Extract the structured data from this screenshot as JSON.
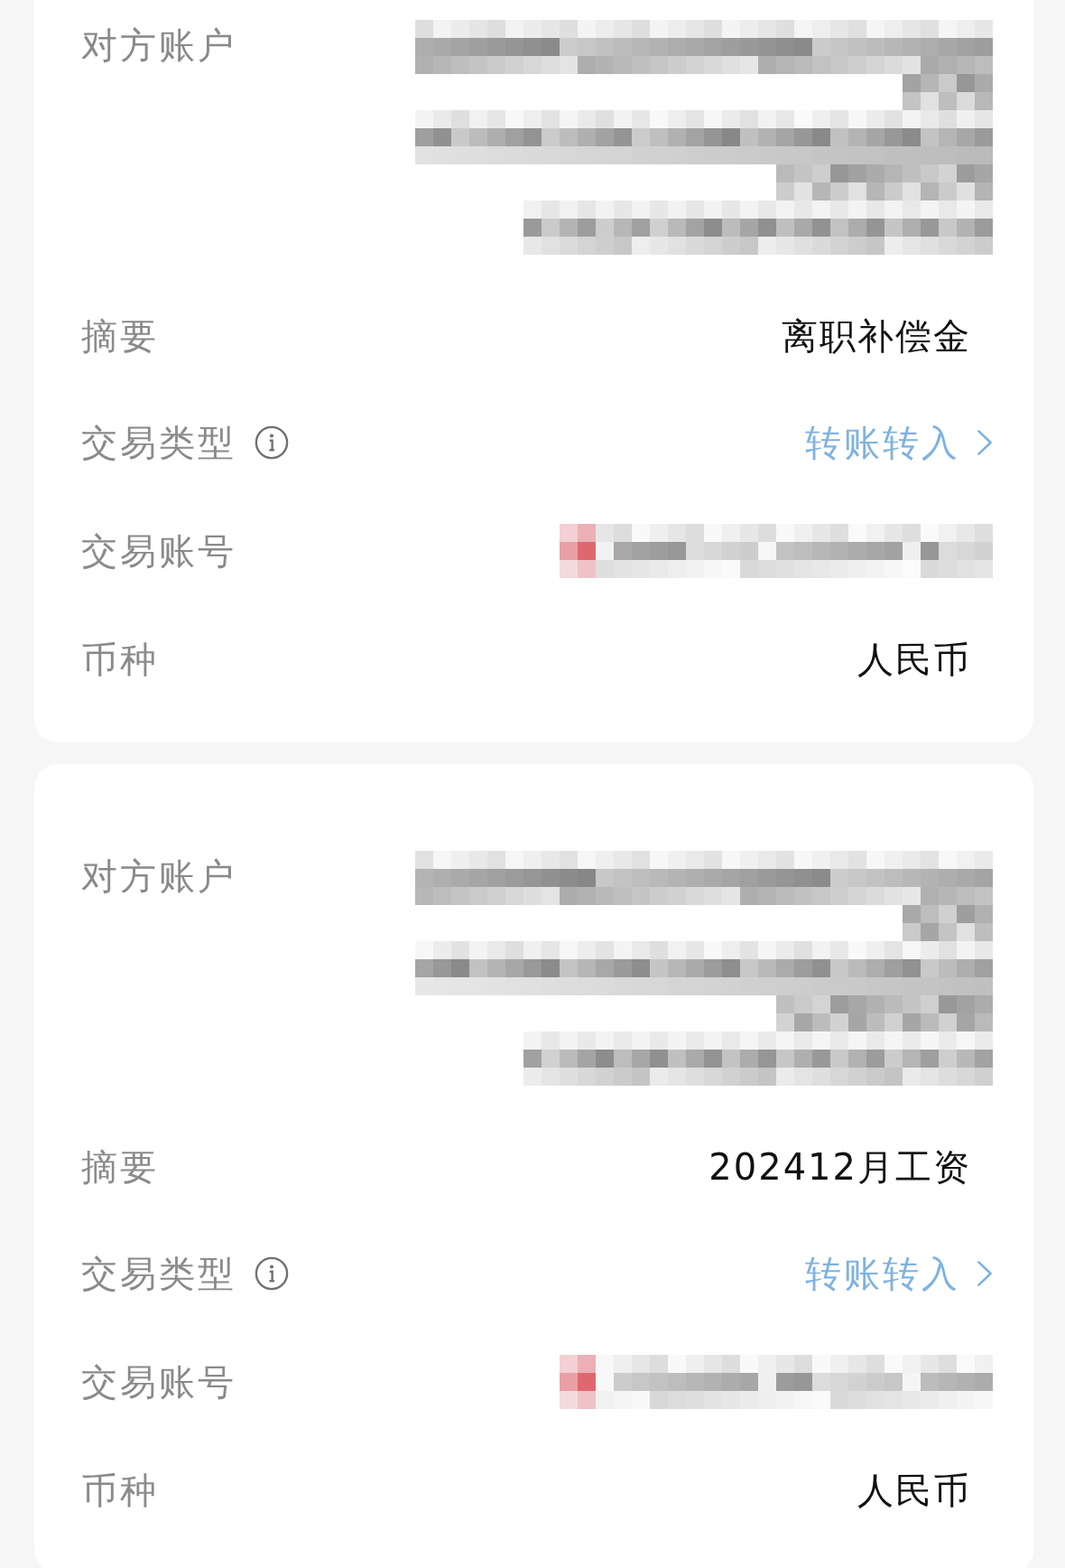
{
  "cards": [
    {
      "rows": [
        {
          "label": "对方账户",
          "info": false,
          "kind": "redacted_lines"
        },
        {
          "label": "摘要",
          "info": false,
          "kind": "text",
          "value": "离职补偿金"
        },
        {
          "label": "交易类型",
          "info": true,
          "kind": "link",
          "value": "转账转入"
        },
        {
          "label": "交易账号",
          "info": false,
          "kind": "redacted_number"
        },
        {
          "label": "币种",
          "info": false,
          "kind": "text",
          "value": "人民币"
        }
      ]
    },
    {
      "rows": [
        {
          "label": "对方账户",
          "info": false,
          "kind": "redacted_lines"
        },
        {
          "label": "摘要",
          "info": false,
          "kind": "text",
          "value": "202412月工资"
        },
        {
          "label": "交易类型",
          "info": true,
          "kind": "link",
          "value": "转账转入"
        },
        {
          "label": "交易账号",
          "info": false,
          "kind": "redacted_number"
        },
        {
          "label": "币种",
          "info": false,
          "kind": "text",
          "value": "人民币"
        }
      ]
    }
  ]
}
